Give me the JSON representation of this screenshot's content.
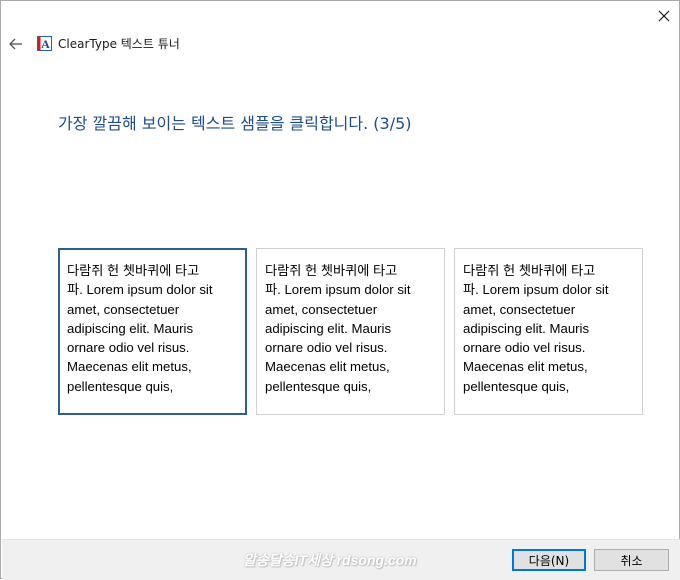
{
  "window": {
    "app_title": "ClearType 텍스트 튜너"
  },
  "main": {
    "heading": "가장 깔끔해 보이는 텍스트 샘플을 클릭합니다. (3/5)",
    "samples": [
      {
        "lines": [
          "다람쥐 헌 쳇바퀴에 타고",
          "파. Lorem ipsum dolor sit",
          "amet, consectetuer",
          "adipiscing elit. Mauris",
          "ornare odio vel risus.",
          "Maecenas elit metus,",
          "pellentesque quis,"
        ],
        "selected": true
      },
      {
        "lines": [
          "다람쥐 헌 쳇바퀴에 타고",
          "파. Lorem ipsum dolor sit",
          "amet, consectetuer",
          "adipiscing elit. Mauris",
          "ornare odio vel risus.",
          "Maecenas elit metus,",
          "pellentesque quis,"
        ],
        "selected": false
      },
      {
        "lines": [
          "다람쥐 헌 쳇바퀴에 타고",
          "파. Lorem ipsum dolor sit",
          "amet, consectetuer",
          "adipiscing elit. Mauris",
          "ornare odio vel risus.",
          "Maecenas elit metus,",
          "pellentesque quis,"
        ],
        "selected": false
      }
    ]
  },
  "footer": {
    "watermark": "알송달송IT세상 rdsong.com",
    "next_label": "다음(N)",
    "cancel_label": "취소"
  },
  "icons": {
    "close": "close-icon",
    "back": "back-arrow-icon",
    "app": "cleartype-app-icon"
  },
  "colors": {
    "heading": "#1d4c8c",
    "selected_border": "#2e5e8a",
    "primary_button_border": "#0078d7",
    "footer_bg": "#f0f0f0"
  }
}
